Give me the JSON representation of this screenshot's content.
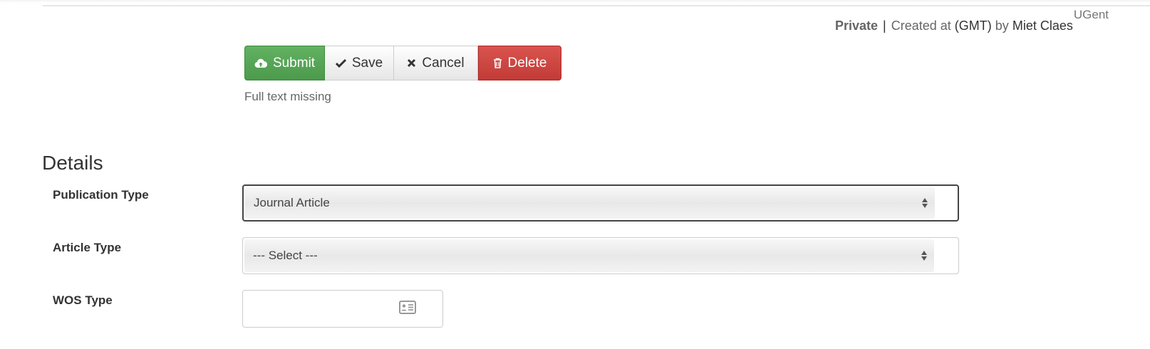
{
  "header": {
    "status": "Private",
    "separator": "|",
    "created_text": "Created at",
    "timezone": "(GMT)",
    "by_text": "by",
    "user": "Miet Claes",
    "org": "UGent"
  },
  "toolbar": {
    "submit_label": "Submit",
    "save_label": "Save",
    "cancel_label": "Cancel",
    "delete_label": "Delete",
    "submit_icon": "cloud-upload-icon",
    "save_icon": "check-icon",
    "cancel_icon": "x-icon",
    "delete_icon": "trash-icon"
  },
  "note": "Full text missing",
  "details": {
    "title": "Details",
    "fields": {
      "publication_type": {
        "label": "Publication Type",
        "value": "Journal Article"
      },
      "article_type": {
        "label": "Article Type",
        "value": "--- Select ---"
      },
      "wos_type": {
        "label": "WOS Type",
        "value": "",
        "icon": "id-card-icon"
      }
    }
  },
  "colors": {
    "submit": "#5cb85c",
    "delete": "#d9534f",
    "text": "#333333"
  }
}
